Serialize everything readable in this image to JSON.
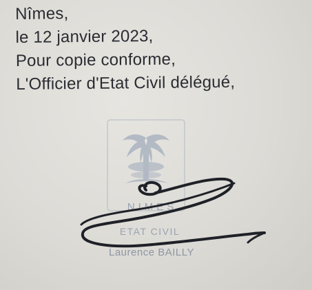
{
  "document": {
    "lines": [
      "Nîmes,",
      "le 12 janvier 2023,",
      "Pour copie conforme,",
      "L'Officier d'Etat Civil délégué,"
    ]
  },
  "stamp": {
    "city": "NIMES",
    "service": "ETAT CIVIL",
    "name": "Laurence BAILLY"
  },
  "colors": {
    "paper": "#dcdbd6",
    "ink_text": "#2b2c33",
    "stamp": "#9aa3b2",
    "signature_ink": "#1f2128"
  }
}
